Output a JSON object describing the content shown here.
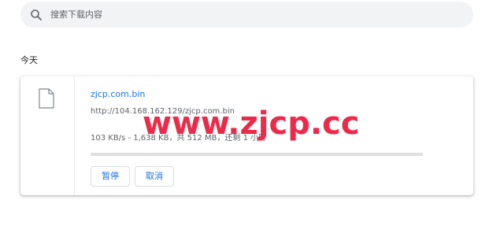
{
  "search": {
    "placeholder": "搜索下载内容",
    "icon": "search-icon"
  },
  "section": {
    "heading": "今天"
  },
  "download": {
    "file_name": "zjcp.com.bin",
    "url": "http://104.168.162.129/zjcp.com.bin",
    "progress_text": "103 KB/s - 1,638 KB，共 512 MB，还剩 1 小时",
    "progress_fraction": 0.003,
    "file_icon": "file-icon",
    "buttons": {
      "pause_label": "暂停",
      "cancel_label": "取消"
    }
  },
  "watermark": {
    "text": "www.zjcp.cc"
  },
  "colors": {
    "accent": "#1a73e8",
    "watermark": "#ee2a4a",
    "search_bg": "#f1f3f4",
    "secondary_text": "#5f6368"
  }
}
